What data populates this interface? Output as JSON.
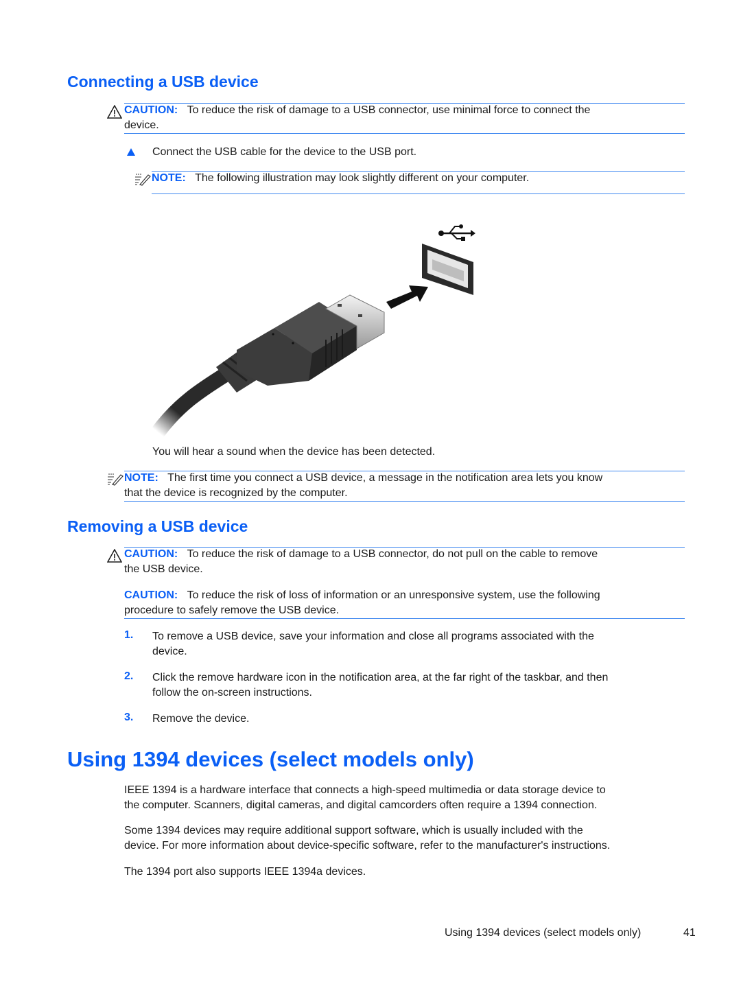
{
  "sections": {
    "connecting": {
      "heading": "Connecting a USB device",
      "caution": {
        "label": "CAUTION:",
        "line1": "To reduce the risk of damage to a USB connector, use minimal force to connect the",
        "line2": "device."
      },
      "step": "Connect the USB cable for the device to the USB port.",
      "note1": {
        "label": "NOTE:",
        "text": "The following illustration may look slightly different on your computer."
      },
      "illustration": "usb-cable-connecting-to-port",
      "after_text": "You will hear a sound when the device has been detected.",
      "note2": {
        "label": "NOTE:",
        "line1": "The first time you connect a USB device, a message in the notification area lets you know",
        "line2": "that the device is recognized by the computer."
      }
    },
    "removing": {
      "heading": "Removing a USB device",
      "caution1": {
        "label": "CAUTION:",
        "line1": "To reduce the risk of damage to a USB connector, do not pull on the cable to remove",
        "line2": "the USB device."
      },
      "caution2": {
        "label": "CAUTION:",
        "line1": "To reduce the risk of loss of information or an unresponsive system, use the following",
        "line2": "procedure to safely remove the USB device."
      },
      "steps": [
        {
          "num": "1.",
          "line1": "To remove a USB device, save your information and close all programs associated with the",
          "line2": "device."
        },
        {
          "num": "2.",
          "line1": "Click the remove hardware icon in the notification area, at the far right of the taskbar, and then",
          "line2": "follow the on-screen instructions."
        },
        {
          "num": "3.",
          "line1": "Remove the device.",
          "line2": ""
        }
      ]
    },
    "ieee1394": {
      "heading": "Using 1394 devices (select models only)",
      "p1_line1": "IEEE 1394 is a hardware interface that connects a high-speed multimedia or data storage device to",
      "p1_line2": "the computer. Scanners, digital cameras, and digital camcorders often require a 1394 connection.",
      "p2_line1": "Some 1394 devices may require additional support software, which is usually included with the",
      "p2_line2": "device. For more information about device-specific software, refer to the manufacturer's instructions.",
      "p3": "The 1394 port also supports IEEE 1394a devices."
    }
  },
  "footer": {
    "chapter_title": "Using 1394 devices (select models only)",
    "page_number": "41"
  },
  "colors": {
    "accent": "#0a5ff5",
    "rule": "#3d86f0",
    "text": "#1a1a1a"
  }
}
